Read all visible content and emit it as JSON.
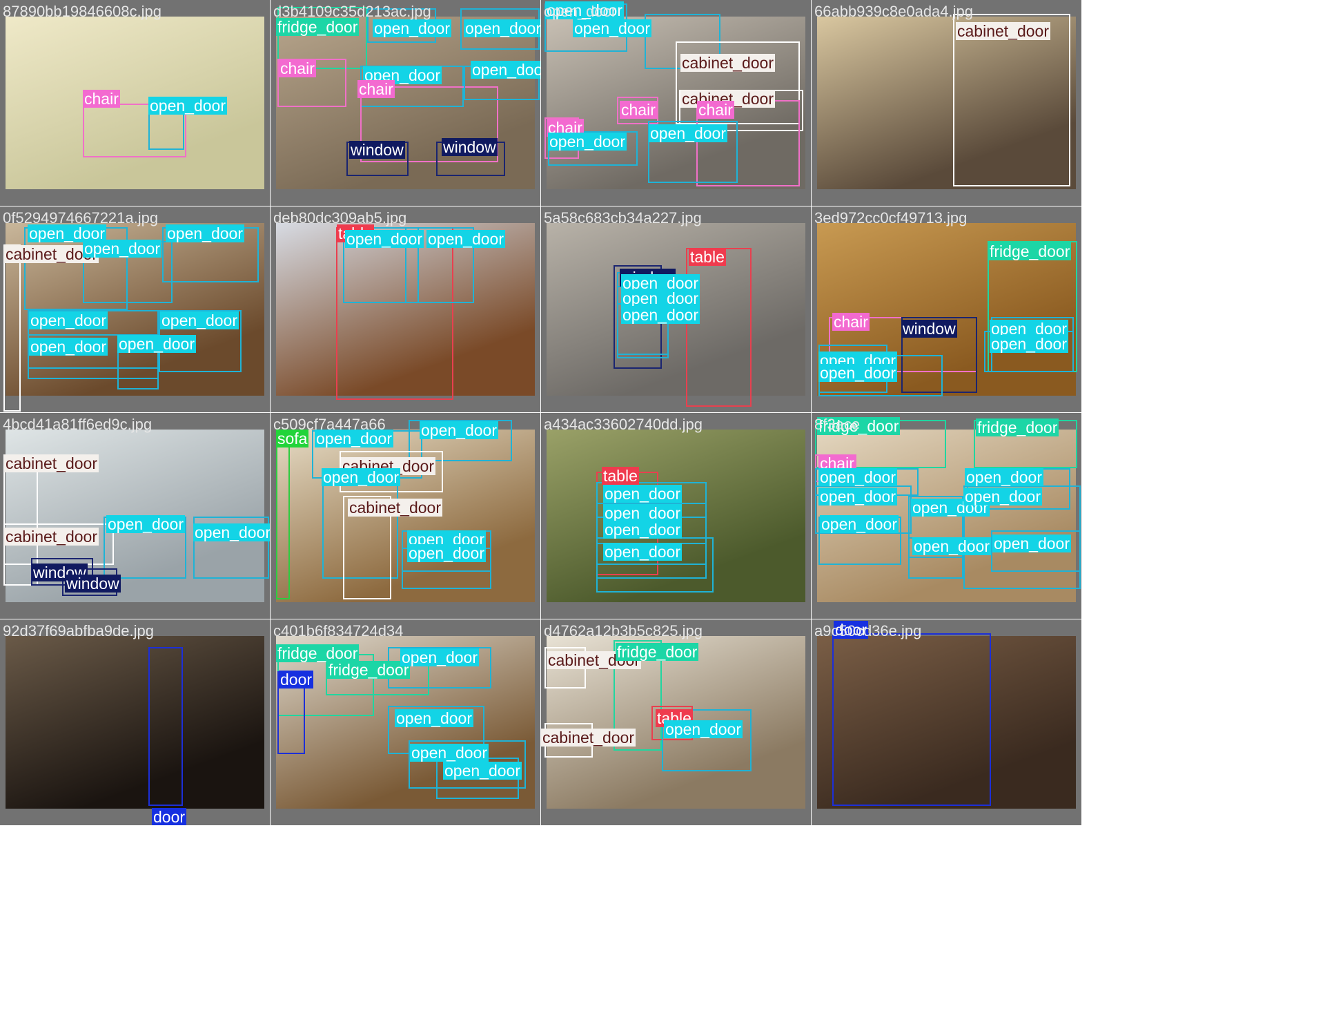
{
  "classes": {
    "open_door": {
      "border": "#1fb3d6",
      "tag_bg": "#13d4e6",
      "tag_fg": "#ffffff"
    },
    "cabinet_door": {
      "border": "#ffffff",
      "tag_bg": "#f4f0ec",
      "tag_fg": "#5a1a1a"
    },
    "chair": {
      "border": "#f070c8",
      "tag_bg": "#f36ad0",
      "tag_fg": "#ffffff"
    },
    "window": {
      "border": "#1a2470",
      "tag_bg": "#101a60",
      "tag_fg": "#ffffff"
    },
    "fridge_door": {
      "border": "#20d6a0",
      "tag_bg": "#1cd6a6",
      "tag_fg": "#ffffff"
    },
    "table": {
      "border": "#e8404f",
      "tag_bg": "#ef3b4e",
      "tag_fg": "#ffffff"
    },
    "sofa": {
      "border": "#2ecc40",
      "tag_bg": "#22d43a",
      "tag_fg": "#ffffff"
    },
    "door": {
      "border": "#1c2fd8",
      "tag_bg": "#1630e0",
      "tag_fg": "#ffffff"
    }
  },
  "tiles": [
    {
      "filename": "87890bb19846608c.jpg",
      "scene": "#c9c69a",
      "scene2": "#efe9c8",
      "detections": [
        {
          "cls": "chair",
          "label": "chair"
        },
        {
          "cls": "open_door",
          "label": "open_door"
        }
      ]
    },
    {
      "filename": "d3b4109c35d213ac.jpg",
      "scene": "#7a6a55",
      "scene2": "#b7a58c",
      "detections": [
        {
          "cls": "fridge_door",
          "label": "fridge_door"
        },
        {
          "cls": "open_door",
          "label": "open_door"
        },
        {
          "cls": "open_door",
          "label": "open_door"
        },
        {
          "cls": "chair",
          "label": "chair"
        },
        {
          "cls": "open_door",
          "label": "open_door"
        },
        {
          "cls": "chair",
          "label": "chair"
        },
        {
          "cls": "open_door",
          "label": "open_door"
        },
        {
          "cls": "window",
          "label": "window"
        },
        {
          "cls": "window",
          "label": "window"
        }
      ]
    },
    {
      "filename": "open_door",
      "scene": "#6f6a63",
      "scene2": "#c8c0b4",
      "detections": [
        {
          "cls": "open_door",
          "label": "open_door"
        },
        {
          "cls": "open_door",
          "label": "open_door"
        },
        {
          "cls": "cabinet_door",
          "label": "cabinet_door"
        },
        {
          "cls": "cabinet_door",
          "label": "cabinet_door"
        },
        {
          "cls": "chair",
          "label": "chair"
        },
        {
          "cls": "chair",
          "label": "chair"
        },
        {
          "cls": "chair",
          "label": "chair"
        },
        {
          "cls": "open_door",
          "label": "open_door"
        },
        {
          "cls": "open_door",
          "label": "open_door"
        }
      ]
    },
    {
      "filename": "66abb939c8e0ada4.jpg",
      "scene": "#5a4a3a",
      "scene2": "#d9c7a0",
      "detections": [
        {
          "cls": "cabinet_door",
          "label": "cabinet_door"
        }
      ]
    },
    {
      "filename": "0f5294974667221a.jpg",
      "scene": "#6b4a2c",
      "scene2": "#c9b79b",
      "detections": [
        {
          "cls": "open_door",
          "label": "open_door"
        },
        {
          "cls": "open_door",
          "label": "open_door"
        },
        {
          "cls": "cabinet_door",
          "label": "cabinet_door"
        },
        {
          "cls": "open_door",
          "label": "open_door"
        },
        {
          "cls": "open_door",
          "label": "open_door"
        },
        {
          "cls": "open_door",
          "label": "open_door"
        },
        {
          "cls": "open_door",
          "label": "open_door"
        },
        {
          "cls": "open_door",
          "label": "open_door"
        }
      ]
    },
    {
      "filename": "deb80dc309ab5.jpg",
      "scene": "#7a4a28",
      "scene2": "#d7dbe3",
      "detections": [
        {
          "cls": "table",
          "label": "table"
        },
        {
          "cls": "open_door",
          "label": "open_door"
        },
        {
          "cls": "open_door",
          "label": "open_door"
        }
      ]
    },
    {
      "filename": "5a58c683cb34a227.jpg",
      "scene": "#6d6a66",
      "scene2": "#b8b2a8",
      "detections": [
        {
          "cls": "window",
          "label": "window"
        },
        {
          "cls": "table",
          "label": "table"
        },
        {
          "cls": "open_door",
          "label": "open_door"
        },
        {
          "cls": "open_door",
          "label": "open_door"
        },
        {
          "cls": "open_door",
          "label": "open_door"
        }
      ]
    },
    {
      "filename": "3ed972cc0cf49713.jpg",
      "scene": "#8a5a20",
      "scene2": "#c89a52",
      "detections": [
        {
          "cls": "fridge_door",
          "label": "fridge_door"
        },
        {
          "cls": "chair",
          "label": "chair"
        },
        {
          "cls": "window",
          "label": "window"
        },
        {
          "cls": "open_door",
          "label": "open_door"
        },
        {
          "cls": "open_door",
          "label": "open_door"
        },
        {
          "cls": "open_door",
          "label": "open_door"
        },
        {
          "cls": "open_door",
          "label": "open_door"
        }
      ]
    },
    {
      "filename": "4bcd41a81ff6ed9c.jpg",
      "scene": "#9aa3a8",
      "scene2": "#dfe5e6",
      "detections": [
        {
          "cls": "cabinet_door",
          "label": "cabinet_door"
        },
        {
          "cls": "cabinet_door",
          "label": "cabinet_door"
        },
        {
          "cls": "open_door",
          "label": "open_door"
        },
        {
          "cls": "open_door",
          "label": "open_door"
        },
        {
          "cls": "window",
          "label": "window"
        },
        {
          "cls": "window",
          "label": "window"
        }
      ]
    },
    {
      "filename": "c509cf7a447a66",
      "scene": "#8d6a3f",
      "scene2": "#e7ddc7",
      "detections": [
        {
          "cls": "sofa",
          "label": "sofa"
        },
        {
          "cls": "open_door",
          "label": "open_door"
        },
        {
          "cls": "open_door",
          "label": "open_door"
        },
        {
          "cls": "cabinet_door",
          "label": "cabinet_door"
        },
        {
          "cls": "open_door",
          "label": "open_door"
        },
        {
          "cls": "cabinet_door",
          "label": "cabinet_door"
        },
        {
          "cls": "open_door",
          "label": "open_door"
        },
        {
          "cls": "open_door",
          "label": "open_door"
        }
      ]
    },
    {
      "filename": "a434ac33602740dd.jpg",
      "scene": "#4c5a2c",
      "scene2": "#9aa168",
      "detections": [
        {
          "cls": "table",
          "label": "table"
        },
        {
          "cls": "open_door",
          "label": "open_door"
        },
        {
          "cls": "open_door",
          "label": "open_door"
        },
        {
          "cls": "open_door",
          "label": "open_door"
        },
        {
          "cls": "open_door",
          "label": "open_door"
        }
      ]
    },
    {
      "filename": "8f3ace",
      "scene": "#a88a62",
      "scene2": "#e3d6bf",
      "detections": [
        {
          "cls": "fridge_door",
          "label": "fridge_door"
        },
        {
          "cls": "fridge_door",
          "label": "fridge_door"
        },
        {
          "cls": "chair",
          "label": "chair"
        },
        {
          "cls": "open_door",
          "label": "open_door"
        },
        {
          "cls": "open_door",
          "label": "open_door"
        },
        {
          "cls": "open_door",
          "label": "open_door"
        },
        {
          "cls": "open_door",
          "label": "open_door"
        },
        {
          "cls": "open_door",
          "label": "open_door"
        },
        {
          "cls": "open_door",
          "label": "open_door"
        },
        {
          "cls": "open_door",
          "label": "open_door"
        },
        {
          "cls": "open_door",
          "label": "open_door"
        }
      ]
    },
    {
      "filename": "92d37f69abfba9de.jpg",
      "scene": "#1a1410",
      "scene2": "#6a5a48",
      "detections": [
        {
          "cls": "door",
          "label": "door"
        }
      ]
    },
    {
      "filename": "c401b6f834724d34",
      "scene": "#7a5a36",
      "scene2": "#ded8cc",
      "detections": [
        {
          "cls": "fridge_door",
          "label": "fridge_door"
        },
        {
          "cls": "door",
          "label": "door"
        },
        {
          "cls": "fridge_door",
          "label": "fridge_door"
        },
        {
          "cls": "open_door",
          "label": "open_door"
        },
        {
          "cls": "open_door",
          "label": "open_door"
        },
        {
          "cls": "open_door",
          "label": "open_door"
        },
        {
          "cls": "open_door",
          "label": "open_door"
        }
      ]
    },
    {
      "filename": "d4762a12b3b5c825.jpg",
      "scene": "#8b7a62",
      "scene2": "#e8e2d5",
      "detections": [
        {
          "cls": "cabinet_door",
          "label": "cabinet_door"
        },
        {
          "cls": "fridge_door",
          "label": "fridge_door"
        },
        {
          "cls": "table",
          "label": "table"
        },
        {
          "cls": "open_door",
          "label": "open_door"
        },
        {
          "cls": "cabinet_door",
          "label": "cabinet_door"
        }
      ]
    },
    {
      "filename": "a9c50cd36e.jpg",
      "scene": "#3a2a1f",
      "scene2": "#7a5e46",
      "detections": [
        {
          "cls": "door",
          "label": "door"
        }
      ]
    }
  ]
}
